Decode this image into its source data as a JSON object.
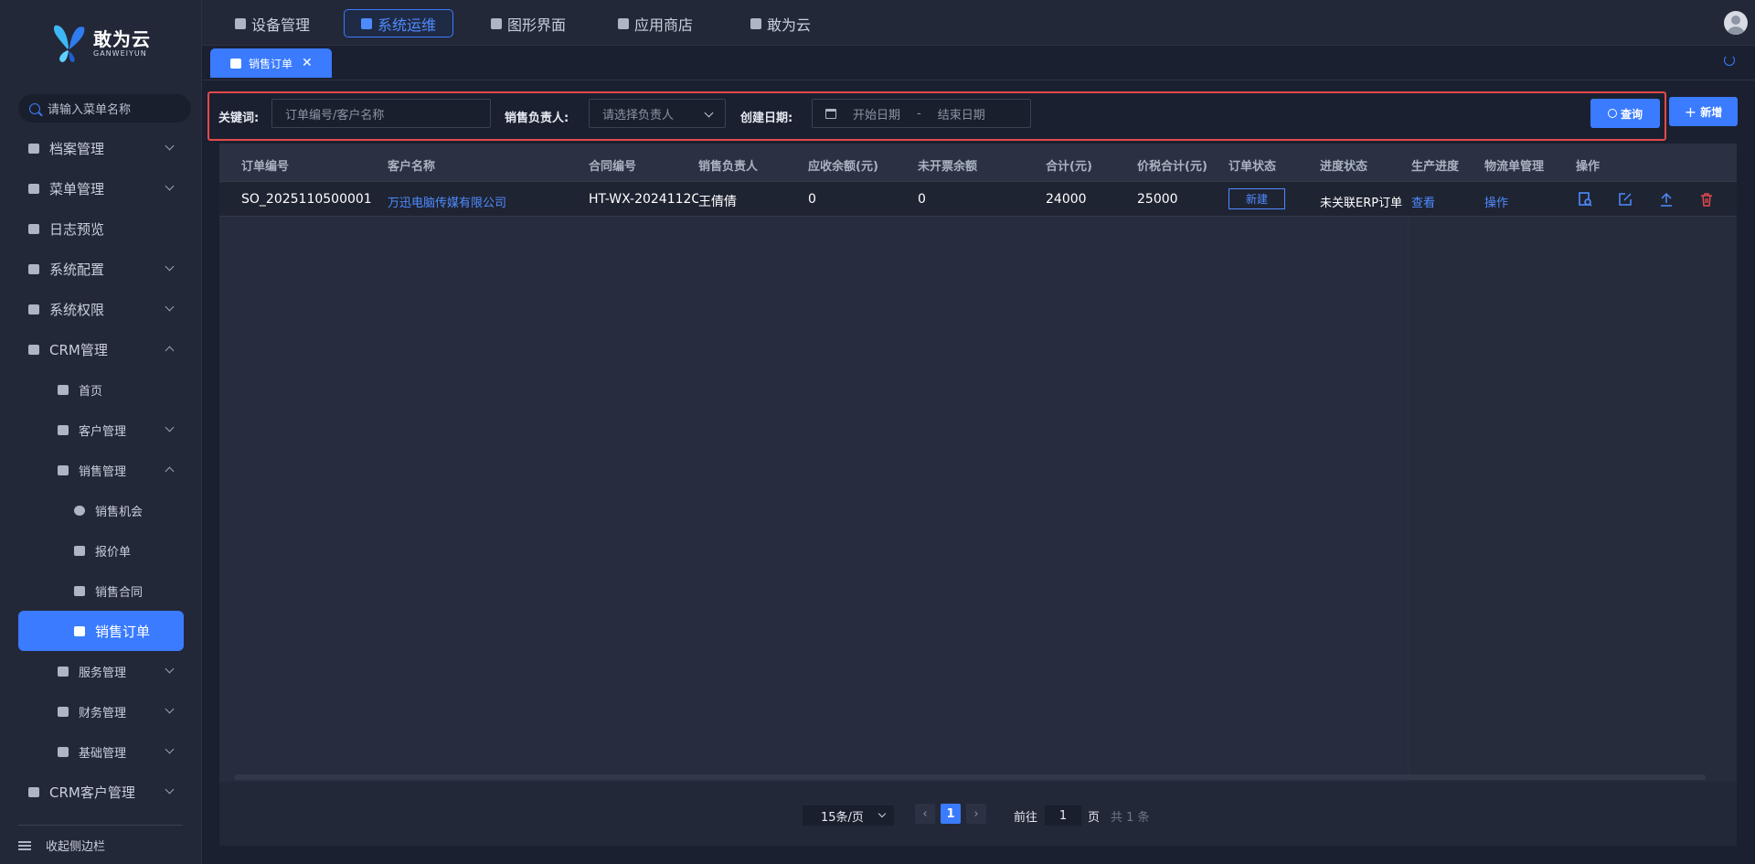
{
  "brand": {
    "name_cn": "敢为云",
    "name_en": "GANWEIYUN"
  },
  "sidebar": {
    "search_placeholder": "请输入菜单名称",
    "items": [
      {
        "label": "档案管理"
      },
      {
        "label": "菜单管理"
      },
      {
        "label": "日志预览"
      },
      {
        "label": "系统配置"
      },
      {
        "label": "系统权限"
      },
      {
        "label": "CRM管理"
      },
      {
        "label": "首页"
      },
      {
        "label": "客户管理"
      },
      {
        "label": "销售管理"
      },
      {
        "label": "销售机会"
      },
      {
        "label": "报价单"
      },
      {
        "label": "销售合同"
      },
      {
        "label": "销售订单"
      },
      {
        "label": "服务管理"
      },
      {
        "label": "财务管理"
      },
      {
        "label": "基础管理"
      },
      {
        "label": "CRM客户管理"
      }
    ],
    "collapse_label": "收起侧边栏"
  },
  "topnav": {
    "items": [
      {
        "label": "设备管理"
      },
      {
        "label": "系统运维"
      },
      {
        "label": "图形界面"
      },
      {
        "label": "应用商店"
      },
      {
        "label": "敢为云"
      }
    ]
  },
  "tabs": [
    {
      "label": "销售订单",
      "close": "✕"
    }
  ],
  "filters": {
    "keyword_label": "关键词:",
    "keyword_placeholder": "订单编号/客户名称",
    "owner_label": "销售负责人:",
    "owner_placeholder": "请选择负责人",
    "date_label": "创建日期:",
    "date_start": "开始日期",
    "date_sep": "-",
    "date_end": "结束日期",
    "query_button": "查询",
    "add_button": "新增"
  },
  "table": {
    "headers": [
      "订单编号",
      "客户名称",
      "合同编号",
      "销售负责人",
      "应收余额(元)",
      "未开票余额",
      "合计(元)",
      "价税合计(元)",
      "订单状态",
      "进度状态",
      "生产进度",
      "物流单管理",
      "操作"
    ],
    "rows": [
      {
        "order_no": "SO_2025110500001",
        "customer": "万迅电脑传媒有限公司",
        "contract": "HT-WX-2024112C",
        "owner": "王倩倩",
        "receivable": "0",
        "uninvoiced": "0",
        "total": "24000",
        "total_tax": "25000",
        "status": "新建",
        "progress": "未关联ERP订单",
        "production": "查看",
        "logistics": "操作"
      }
    ]
  },
  "pagination": {
    "page_size": "15条/页",
    "current_page": "1",
    "goto_label": "前往",
    "goto_value": "1",
    "page_unit": "页",
    "total": "共 1 条",
    "prev": "‹",
    "next": "›"
  },
  "colors": {
    "accent": "#3a7bff",
    "danger": "#e34a4a",
    "bg": "#1b2030"
  }
}
